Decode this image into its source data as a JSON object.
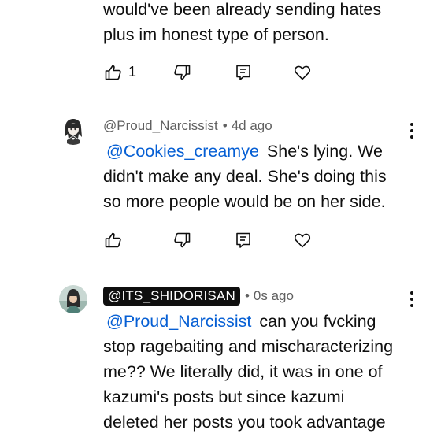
{
  "comments": [
    {
      "lines": [
        "would've been already sending hates",
        "plus im honest type of person."
      ],
      "like_count": "1"
    },
    {
      "author": "@Proud_Narcissist",
      "separator": "•",
      "time": "4d ago",
      "mention": "@Cookies_creamye",
      "text_first": "She's lying. We",
      "lines": [
        "didn't make any deal. She's doing this",
        "so more people would be on her side."
      ]
    },
    {
      "author": "@ITS_SHIDORISAN",
      "separator": "•",
      "time": "0s ago",
      "mention": "@Proud_Narcissist",
      "text_first": "can you fvcking",
      "lines": [
        "stop ragebaiting and mischaracterizing",
        "me?? We literally did, it was in one of",
        "kazumi's posts but since kazumi",
        "deleted her posts you took advantage"
      ]
    }
  ],
  "icons": {
    "like": "thumb-up-icon",
    "dislike": "thumb-down-icon",
    "reply": "reply-icon",
    "heart": "heart-icon",
    "more": "more-vertical-icon"
  },
  "colors": {
    "mention": "#065fd4",
    "meta": "#606060",
    "text": "#0f0f0f",
    "author_badge": "#0f0f0f"
  }
}
